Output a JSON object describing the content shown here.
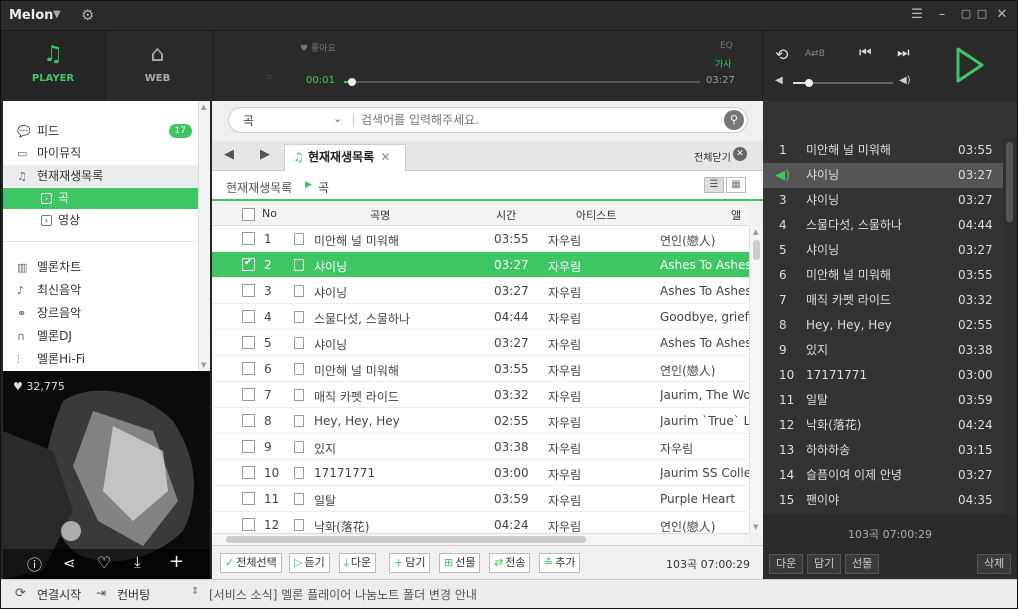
{
  "app": {
    "title": "Melon"
  },
  "nav": {
    "player": "PLAYER",
    "web": "WEB"
  },
  "player": {
    "like": "좋아요",
    "eq": "EQ",
    "lyrics": "가사",
    "elapsed": "00:01",
    "duration": "03:27",
    "progress": 0.01,
    "ab": "A⇄B",
    "volume": 0.12
  },
  "sidebar": {
    "items": [
      {
        "label": "피드",
        "icon": "speech-bubble-icon",
        "badge": "17"
      },
      {
        "label": "마이뮤직",
        "icon": "folder-icon"
      },
      {
        "label": "현재재생목록",
        "icon": "playlist-icon"
      }
    ],
    "subitems": [
      {
        "label": "곡"
      },
      {
        "label": "영상"
      }
    ],
    "more": [
      {
        "label": "멜론차트",
        "icon": "chart-icon"
      },
      {
        "label": "최신음악",
        "icon": "note-icon"
      },
      {
        "label": "장르음악",
        "icon": "genre-icon"
      },
      {
        "label": "멜론DJ",
        "icon": "headphones-icon"
      },
      {
        "label": "멜론Hi-Fi",
        "icon": "hifi-icon"
      }
    ],
    "likes": "32,775"
  },
  "search": {
    "category": "곡",
    "placeholder": "검색어를 입력해주세요."
  },
  "tabs": {
    "active": "현재재생목록",
    "close_all": "전체닫기"
  },
  "breadcrumb": {
    "root": "현재재생목록",
    "current": "곡"
  },
  "table": {
    "headers": {
      "no": "No",
      "title": "곡명",
      "time": "시간",
      "artist": "아티스트",
      "album": "앨범"
    },
    "rows": [
      {
        "no": "1",
        "title": "미안해 널 미워해",
        "time": "03:55",
        "artist": "자우림",
        "album": "연인(戀人)"
      },
      {
        "no": "2",
        "title": "샤이닝",
        "time": "03:27",
        "artist": "자우림",
        "album": "Ashes To Ashes"
      },
      {
        "no": "3",
        "title": "샤이닝",
        "time": "03:27",
        "artist": "자우림",
        "album": "Ashes To Ashes"
      },
      {
        "no": "4",
        "title": "스물다섯, 스물하나",
        "time": "04:44",
        "artist": "자우림",
        "album": "Goodbye, grief."
      },
      {
        "no": "5",
        "title": "샤이닝",
        "time": "03:27",
        "artist": "자우림",
        "album": "Ashes To Ashes"
      },
      {
        "no": "6",
        "title": "미안해 널 미워해",
        "time": "03:55",
        "artist": "자우림",
        "album": "연인(戀人)"
      },
      {
        "no": "7",
        "title": "매직 카펫 라이드",
        "time": "03:32",
        "artist": "자우림",
        "album": "Jaurim, The Wonder"
      },
      {
        "no": "8",
        "title": "Hey, Hey, Hey",
        "time": "02:55",
        "artist": "자우림",
        "album": "Jaurim `True` Live"
      },
      {
        "no": "9",
        "title": "있지",
        "time": "03:38",
        "artist": "자우림",
        "album": "자우림"
      },
      {
        "no": "10",
        "title": "17171771",
        "time": "03:00",
        "artist": "자우림",
        "album": "Jaurim SS Collection"
      },
      {
        "no": "11",
        "title": "일탈",
        "time": "03:59",
        "artist": "자우림",
        "album": "Purple Heart"
      },
      {
        "no": "12",
        "title": "낙화(落花)",
        "time": "04:24",
        "artist": "자우림",
        "album": "연인(戀人)"
      }
    ],
    "selected_index": 1
  },
  "bottom": {
    "select_all": "전체선택",
    "listen": "듣기",
    "download": "다운",
    "add": "담기",
    "gift": "선물",
    "send": "전송",
    "more": "추가",
    "summary": "103곡 07:00:29"
  },
  "playlist": {
    "items": [
      {
        "no": "1",
        "title": "미안해 널 미워해",
        "time": "03:55"
      },
      {
        "no": "",
        "title": "샤이닝",
        "time": "03:27"
      },
      {
        "no": "3",
        "title": "샤이닝",
        "time": "03:27"
      },
      {
        "no": "4",
        "title": "스물다섯, 스물하나",
        "time": "04:44"
      },
      {
        "no": "5",
        "title": "샤이닝",
        "time": "03:27"
      },
      {
        "no": "6",
        "title": "미안해 널 미워해",
        "time": "03:55"
      },
      {
        "no": "7",
        "title": "매직 카펫 라이드",
        "time": "03:32"
      },
      {
        "no": "8",
        "title": "Hey, Hey, Hey",
        "time": "02:55"
      },
      {
        "no": "9",
        "title": "있지",
        "time": "03:38"
      },
      {
        "no": "10",
        "title": "17171771",
        "time": "03:00"
      },
      {
        "no": "11",
        "title": "일탈",
        "time": "03:59"
      },
      {
        "no": "12",
        "title": "낙화(落花)",
        "time": "04:24"
      },
      {
        "no": "13",
        "title": "하하하송",
        "time": "03:15"
      },
      {
        "no": "14",
        "title": "슬픔이여 이제 안녕",
        "time": "03:27"
      },
      {
        "no": "15",
        "title": "팬이야",
        "time": "04:35"
      }
    ],
    "summary": "103곡 07:00:29",
    "download": "다운",
    "add": "담기",
    "gift": "선물",
    "delete": "삭제"
  },
  "status": {
    "connect": "연결시작",
    "convert": "컨버팅",
    "notice": "[서비스 소식] 멜론 플레이어 나눔노트 폴더 변경 안내"
  },
  "colors": {
    "accent": "#3ec665",
    "dark": "#2b2b2b"
  }
}
